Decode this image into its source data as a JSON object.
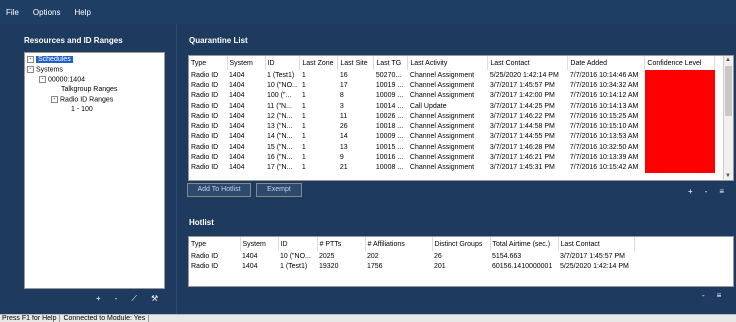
{
  "menu": [
    "File",
    "Options",
    "Help"
  ],
  "left_panel": {
    "title": "Resources and ID Ranges",
    "tree": [
      {
        "label": "Schedules",
        "selected": true
      },
      {
        "label": "Systems"
      },
      {
        "label": "00000:1404"
      },
      {
        "label": "Talkgroup Ranges"
      },
      {
        "label": "Radio ID Ranges"
      },
      {
        "label": "1 - 100"
      }
    ],
    "icons": [
      "plus-icon",
      "minus-icon",
      "edit-icon",
      "tools-icon"
    ],
    "icon_glyphs": [
      "+",
      "-",
      "⟋",
      "⚒"
    ]
  },
  "quarantine": {
    "title": "Quarantine List",
    "columns": [
      "Type",
      "System",
      "ID",
      "Last Zone",
      "Last Site",
      "Last TG",
      "Last Activity",
      "Last Contact",
      "Date Added",
      "Confidence Level"
    ],
    "rows": [
      [
        "Radio ID",
        "1404",
        "1 (Test1)",
        "1",
        "16",
        "50270...",
        "Channel Assignment",
        "5/25/2020 1:42:14 PM",
        "7/7/2016 10:14:46 AM",
        "100%"
      ],
      [
        "Radio ID",
        "1404",
        "10 (\"NO...",
        "1",
        "17",
        "10019 ...",
        "Channel Assignment",
        "3/7/2017 1:45:57 PM",
        "7/7/2016 10:34:32 AM",
        "100%"
      ],
      [
        "Radio ID",
        "1404",
        "100 (\"...",
        "1",
        "8",
        "10009 ...",
        "Channel Assignment",
        "3/7/2017 1:42:00 PM",
        "7/7/2016 10:14:12 AM",
        "100%"
      ],
      [
        "Radio ID",
        "1404",
        "11 (\"N...",
        "1",
        "3",
        "10014 ...",
        "Call Update",
        "3/7/2017 1:44:25 PM",
        "7/7/2016 10:14:13 AM",
        "100%"
      ],
      [
        "Radio ID",
        "1404",
        "12 (\"N...",
        "1",
        "11",
        "10026 ...",
        "Channel Assignment",
        "3/7/2017 1:46:22 PM",
        "7/7/2016 10:15:25 AM",
        "100%"
      ],
      [
        "Radio ID",
        "1404",
        "13 (\"N...",
        "1",
        "26",
        "10018 ...",
        "Channel Assignment",
        "3/7/2017 1:44:58 PM",
        "7/7/2016 10:15:10 AM",
        "100%"
      ],
      [
        "Radio ID",
        "1404",
        "14 (\"N...",
        "1",
        "14",
        "10009 ...",
        "Channel Assignment",
        "3/7/2017 1:44:55 PM",
        "7/7/2016 10:13:53 AM",
        "100%"
      ],
      [
        "Radio ID",
        "1404",
        "15 (\"N...",
        "1",
        "13",
        "10015 ...",
        "Channel Assignment",
        "3/7/2017 1:46:28 PM",
        "7/7/2016 10:32:50 AM",
        "100%"
      ],
      [
        "Radio ID",
        "1404",
        "16 (\"N...",
        "1",
        "9",
        "10016 ...",
        "Channel Assignment",
        "3/7/2017 1:46:21 PM",
        "7/7/2016 10:13:39 AM",
        "100%"
      ],
      [
        "Radio ID",
        "1404",
        "17 (\"N...",
        "1",
        "21",
        "10008 ...",
        "Channel Assignment",
        "3/7/2017 1:45:31 PM",
        "7/7/2016 10:15:42 AM",
        "100%"
      ]
    ],
    "add_to_hotlist": "Add To Hotlist",
    "exempt": "Exempt",
    "icon_glyphs": [
      "+",
      "-",
      "≡"
    ]
  },
  "hotlist": {
    "title": "Hotlist",
    "columns": [
      "Type",
      "System",
      "ID",
      "# PTTs",
      "# Affiliations",
      "Distinct Groups",
      "Total Airtime (sec.)",
      "Last Contact"
    ],
    "rows": [
      [
        "Radio ID",
        "1404",
        "10 (\"NO...",
        "2025",
        "202",
        "26",
        "5154.663",
        "3/7/2017 1:45:57 PM"
      ],
      [
        "Radio ID",
        "1404",
        "1 (Test1)",
        "19320",
        "1756",
        "201",
        "60156.1410000001",
        "5/25/2020 1:42:14 PM"
      ]
    ],
    "icon_glyphs": [
      "-",
      "≡"
    ]
  },
  "status": [
    "Press F1 for Help",
    "Connected to Module: Yes"
  ],
  "colors": {
    "background": "#1e3a5f",
    "confidence_fill": "#ff0000",
    "selection": "#2160c4"
  }
}
